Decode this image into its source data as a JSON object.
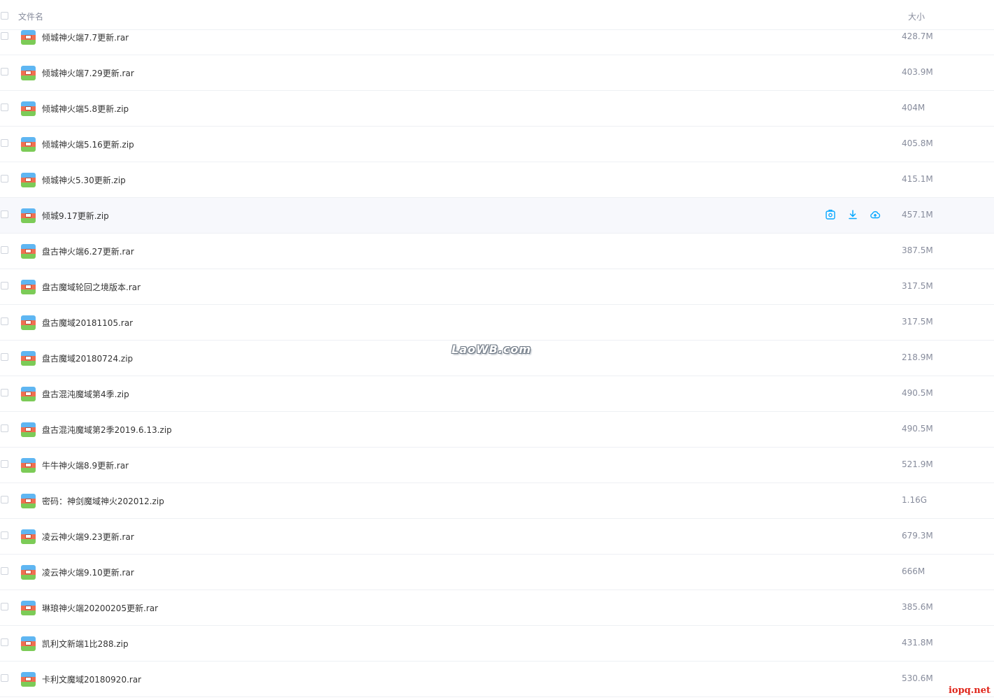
{
  "header": {
    "name_label": "文件名",
    "size_label": "大小"
  },
  "rows": [
    {
      "name": "倾城神火端7.7更新.rar",
      "size": "428.7M"
    },
    {
      "name": "倾城神火端7.29更新.rar",
      "size": "403.9M"
    },
    {
      "name": "倾城神火端5.8更新.zip",
      "size": "404M"
    },
    {
      "name": "倾城神火端5.16更新.zip",
      "size": "405.8M"
    },
    {
      "name": "倾城神火5.30更新.zip",
      "size": "415.1M"
    },
    {
      "name": "倾城9.17更新.zip",
      "size": "457.1M"
    },
    {
      "name": "盘古神火端6.27更新.rar",
      "size": "387.5M"
    },
    {
      "name": "盘古魔域轮回之境版本.rar",
      "size": "317.5M"
    },
    {
      "name": "盘古魔域20181105.rar",
      "size": "317.5M"
    },
    {
      "name": "盘古魔域20180724.zip",
      "size": "218.9M"
    },
    {
      "name": "盘古混沌魔域第4季.zip",
      "size": "490.5M"
    },
    {
      "name": "盘古混沌魔域第2季2019.6.13.zip",
      "size": "490.5M"
    },
    {
      "name": "牛牛神火端8.9更新.rar",
      "size": "521.9M"
    },
    {
      "name": "密码：神剑魔域神火202012.zip",
      "size": "1.16G"
    },
    {
      "name": "凌云神火端9.23更新.rar",
      "size": "679.3M"
    },
    {
      "name": "凌云神火端9.10更新.rar",
      "size": "666M"
    },
    {
      "name": "琳琅神火端20200205更新.rar",
      "size": "385.6M"
    },
    {
      "name": "凯利文新端1比288.zip",
      "size": "431.8M"
    },
    {
      "name": "卡利文魔域20180920.rar",
      "size": "530.6M"
    }
  ],
  "hover_actions": {
    "icons": [
      "share-icon",
      "download-icon",
      "cloud-save-icon"
    ],
    "color": "#06a7ff"
  },
  "watermark": "LaoWB.com",
  "corner_badge": "iopq.net"
}
